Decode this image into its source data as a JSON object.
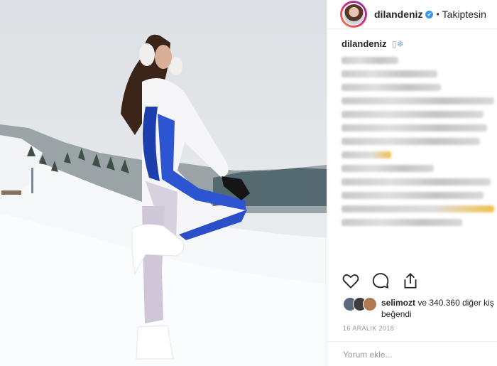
{
  "header": {
    "username": "dilandeniz",
    "verified_symbol": "✔",
    "separator": "•",
    "follow_label": "Takiptesin"
  },
  "caption": {
    "username": "dilandeniz",
    "emoji": "▯❄"
  },
  "actions": {
    "like_icon": "heart-icon",
    "comment_icon": "comment-icon",
    "share_icon": "share-icon"
  },
  "likes": {
    "first_user": "selimozt",
    "rest_text": "ve 340.360 diğer kiş",
    "second_line": "beğendi"
  },
  "post": {
    "date": "16 ARALIK 2018"
  },
  "comment": {
    "placeholder": "Yorum ekle..."
  },
  "colors": {
    "accent": "#3897f0",
    "text": "#262626",
    "muted": "#999999"
  }
}
